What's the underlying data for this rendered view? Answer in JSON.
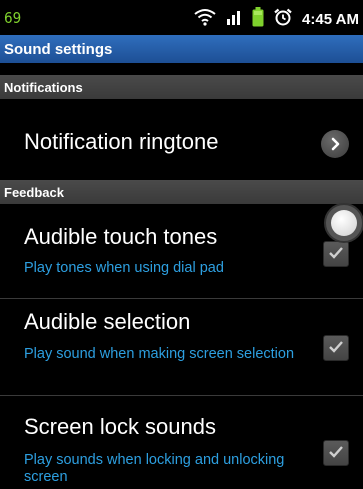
{
  "status_bar": {
    "battery_percent": "69",
    "time": "4:45 AM",
    "icons": [
      "wifi-icon",
      "signal-icon",
      "battery-icon",
      "alarm-icon"
    ]
  },
  "title": "Sound settings",
  "sections": {
    "notifications": "Notifications",
    "feedback": "Feedback"
  },
  "items": {
    "notification_ringtone": {
      "title": "Notification ringtone"
    },
    "audible_touch_tones": {
      "title": "Audible touch tones",
      "summary": "Play tones when using dial pad",
      "checked": true
    },
    "audible_selection": {
      "title": "Audible selection",
      "summary": "Play sound when making screen selection",
      "checked": true
    },
    "screen_lock_sounds": {
      "title": "Screen lock sounds",
      "summary": "Play sounds when locking and unlocking screen",
      "checked": true
    }
  },
  "colors": {
    "title_bar": "#2f6ebd",
    "summary_text": "#2d9fe0",
    "battery_text": "#7fd12d",
    "section_header": "#424242"
  }
}
